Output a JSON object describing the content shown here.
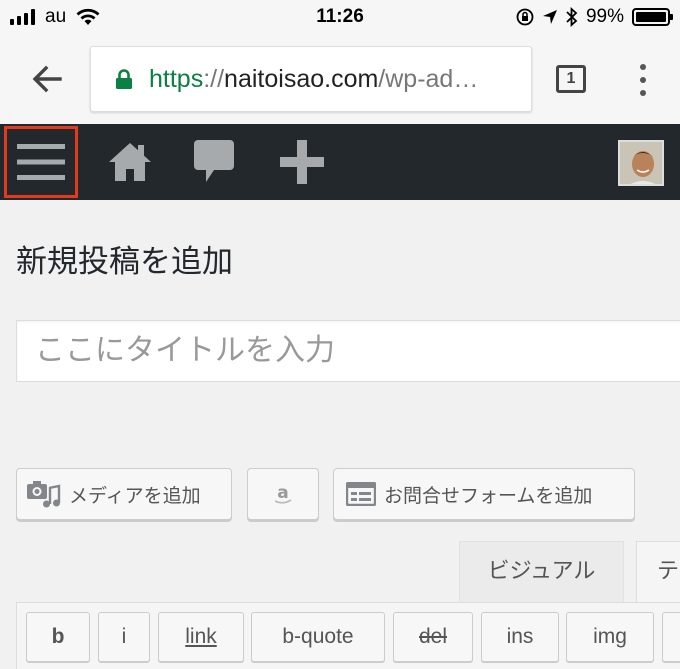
{
  "status_bar": {
    "carrier": "au",
    "time": "11:26",
    "battery": "99%",
    "battery_level": 0.99
  },
  "browser": {
    "url_scheme": "https",
    "url_sep": "://",
    "url_host": "naitoisao.com",
    "url_path": "/wp-ad…",
    "tab_count": "1"
  },
  "admin_bar": {
    "icons": [
      "menu-icon",
      "home-icon",
      "comment-icon",
      "plus-icon",
      "avatar"
    ]
  },
  "editor": {
    "page_title": "新規投稿を追加",
    "title_placeholder": "ここにタイトルを入力",
    "media_button": "メディアを追加",
    "form_button": "お問合せフォームを追加",
    "tab_visual": "ビジュアル",
    "tab_text": "テ",
    "quicktags": [
      "b",
      "i",
      "link",
      "b-quote",
      "del",
      "ins",
      "img"
    ]
  },
  "colors": {
    "admin_bar": "#23282d",
    "highlight": "#e03a1f",
    "secure": "#0b8043"
  }
}
